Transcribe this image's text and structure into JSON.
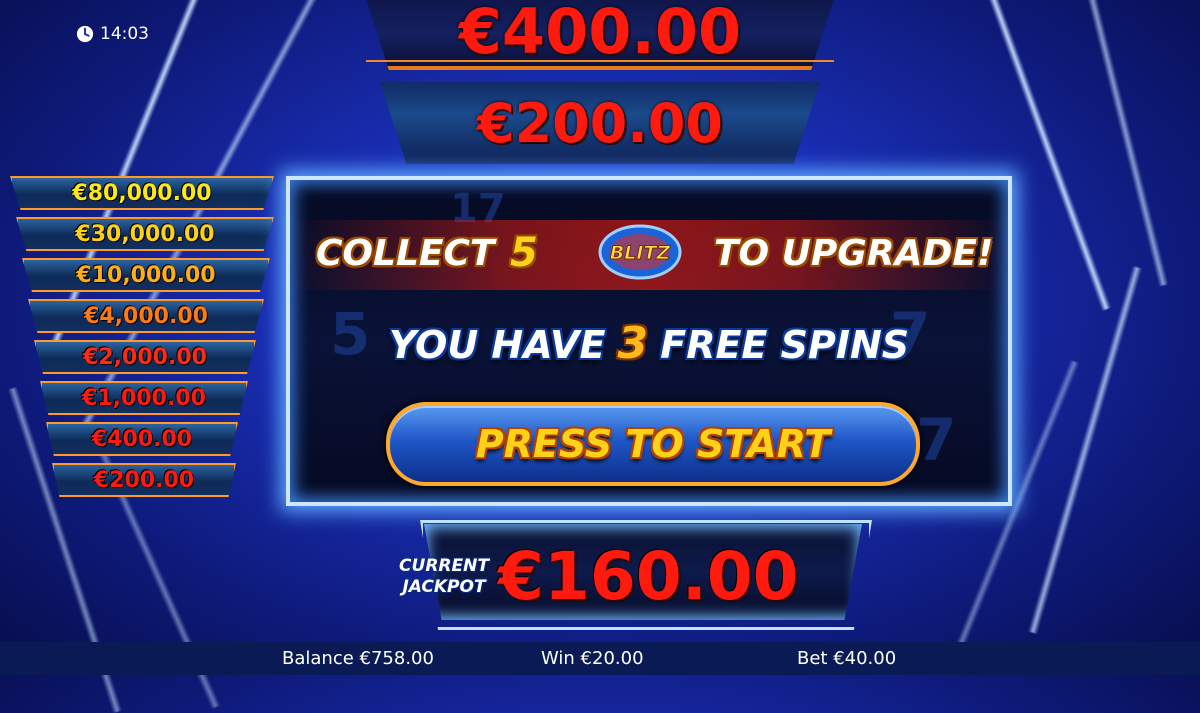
{
  "clock": {
    "time": "14:03",
    "icon": "clock-icon"
  },
  "top_prizes": [
    {
      "label": "€400.00"
    },
    {
      "label": "€200.00"
    }
  ],
  "ladder": [
    {
      "label": "€80,000.00",
      "color": "#ffe71a"
    },
    {
      "label": "€30,000.00",
      "color": "#ffd01a"
    },
    {
      "label": "€10,000.00",
      "color": "#ffae18"
    },
    {
      "label": "€4,000.00",
      "color": "#ff7a14"
    },
    {
      "label": "€2,000.00",
      "color": "#ff2a12"
    },
    {
      "label": "€1,000.00",
      "color": "#ff1a10"
    },
    {
      "label": "€400.00",
      "color": "#ff1a10"
    },
    {
      "label": "€200.00",
      "color": "#ff1a10"
    }
  ],
  "panel": {
    "collect_label": "COLLECT",
    "collect_count": "5",
    "blitz_logo_text": "BLITZ",
    "upgrade_label": "TO UPGRADE!",
    "spins_prefix": "YOU HAVE",
    "spins_count": "3",
    "spins_suffix": "FREE SPINS",
    "start_button": "PRESS TO START"
  },
  "jackpot": {
    "label_line1": "CURRENT",
    "label_line2": "JACKPOT",
    "value": "€160.00"
  },
  "bottom_bar": {
    "balance": "Balance €758.00",
    "win": "Win €20.00",
    "bet": "Bet €40.00"
  },
  "colors": {
    "accent_orange": "#ff9a2a",
    "prize_red": "#ff1a10",
    "background_blue": "#1a2fb8"
  }
}
